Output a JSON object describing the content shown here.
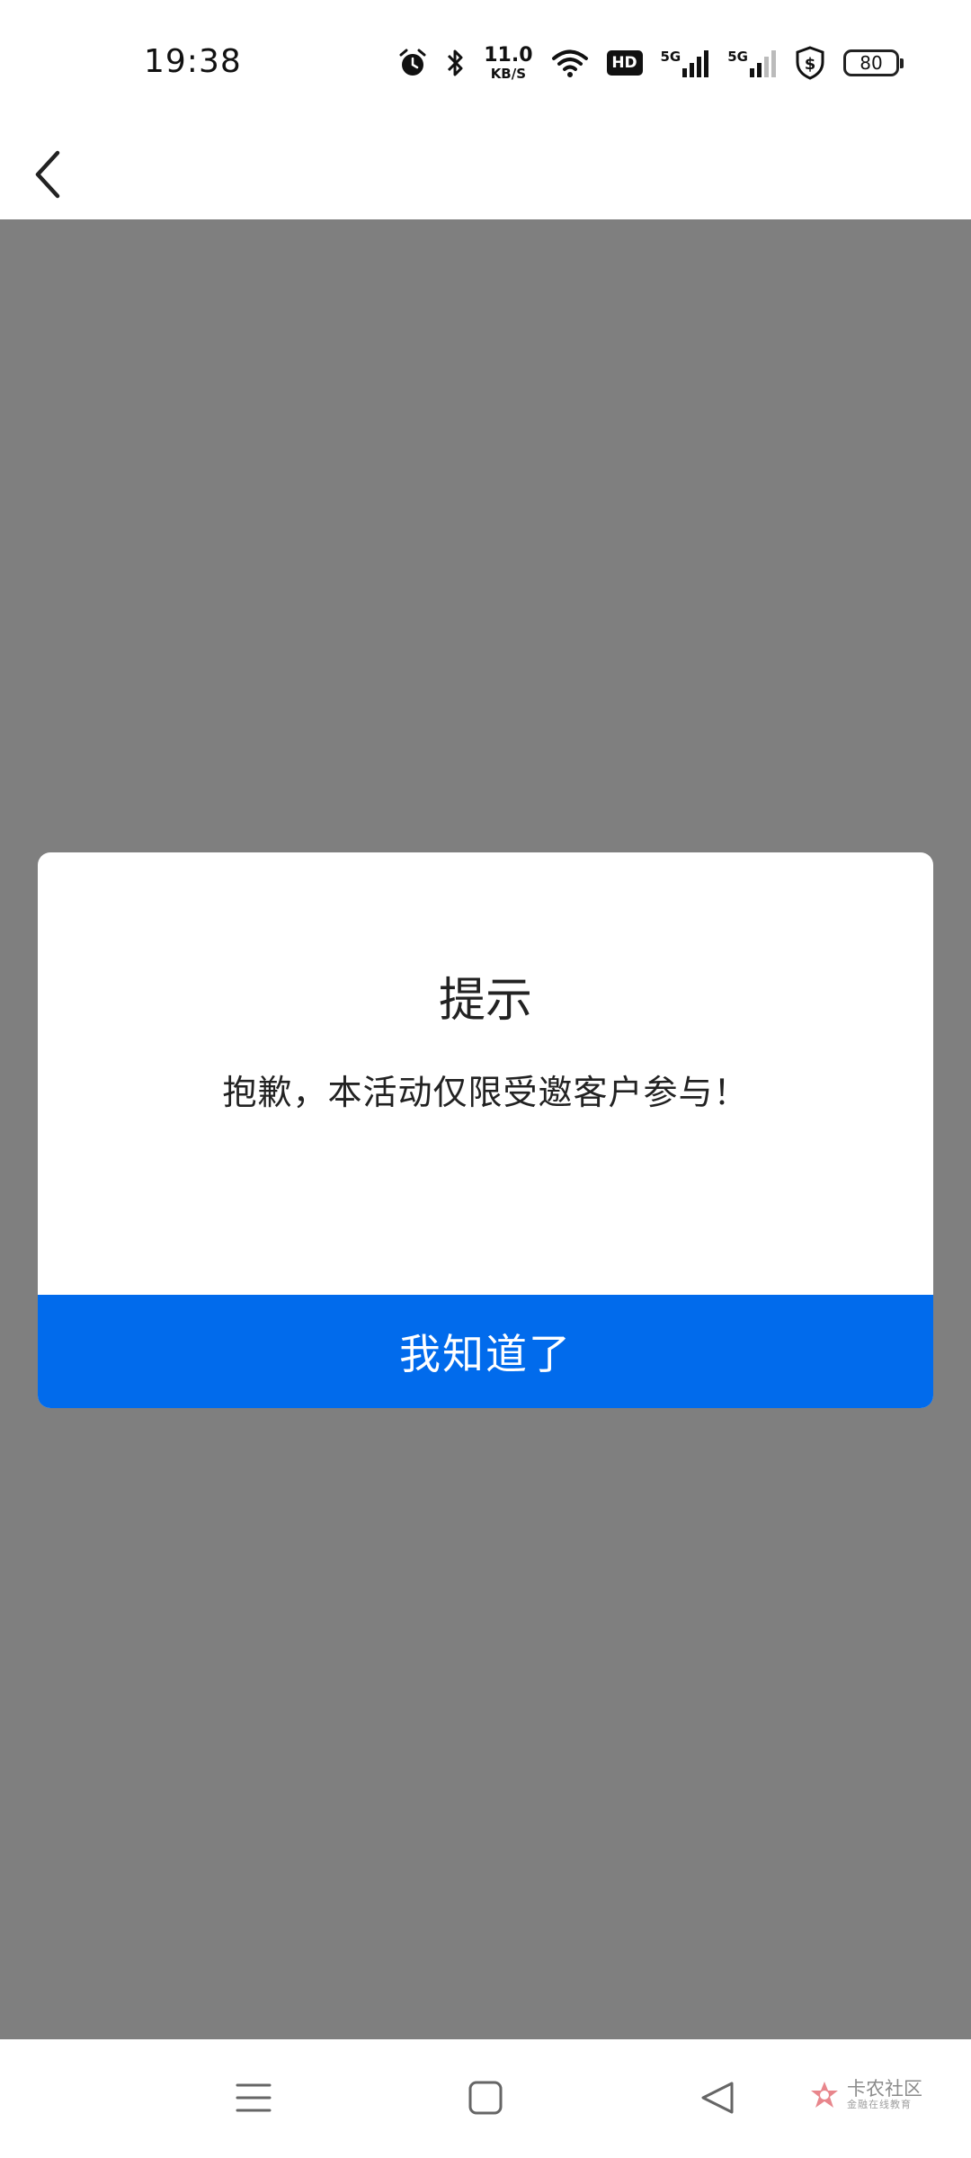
{
  "status_bar": {
    "time": "19:38",
    "net_speed_value": "11.0",
    "net_speed_unit": "KB/S",
    "hd_label": "HD",
    "signal_1_label": "5G",
    "signal_2_label": "5G",
    "battery_level": "80",
    "icons": [
      "alarm-icon",
      "bluetooth-icon",
      "wifi-icon",
      "hd-icon",
      "signal-5g-icon",
      "signal-5g-icon",
      "shield-dollar-icon",
      "battery-icon"
    ]
  },
  "header": {
    "back_icon": "chevron-left-icon"
  },
  "dialog": {
    "title": "提示",
    "message": "抱歉，本活动仅限受邀客户参与！",
    "confirm_label": "我知道了",
    "confirm_color": "#016bec"
  },
  "overlay": {
    "color": "#7f7f7f"
  },
  "system_nav": {
    "icons": [
      "menu-icon",
      "home-icon",
      "back-triangle-icon"
    ]
  },
  "watermark": {
    "main": "卡农社区",
    "sub": "金融在线教育"
  }
}
